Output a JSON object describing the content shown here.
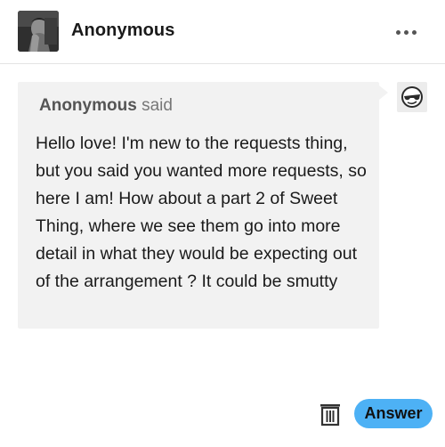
{
  "header": {
    "blog_name": "Anonymous",
    "avatar_icon": "profile-photo",
    "more_icon": "more-horizontal-icon"
  },
  "ask": {
    "asker_name": "Anonymous",
    "said_label": "said",
    "question_text": "Hello love! I'm new to the requests thing, but you said you wanted more requests, so here I am! How about a part 2 of Sweet Thing, where we see them go into more detail in what they would be expecting out of the arrangement ? It could be smutty",
    "asker_avatar_icon": "sunglasses-face-icon",
    "bubble_color": "#f2f2f2"
  },
  "actions": {
    "delete_icon": "trash-icon",
    "answer_label": "Answer",
    "answer_color": "#4db1f5"
  }
}
